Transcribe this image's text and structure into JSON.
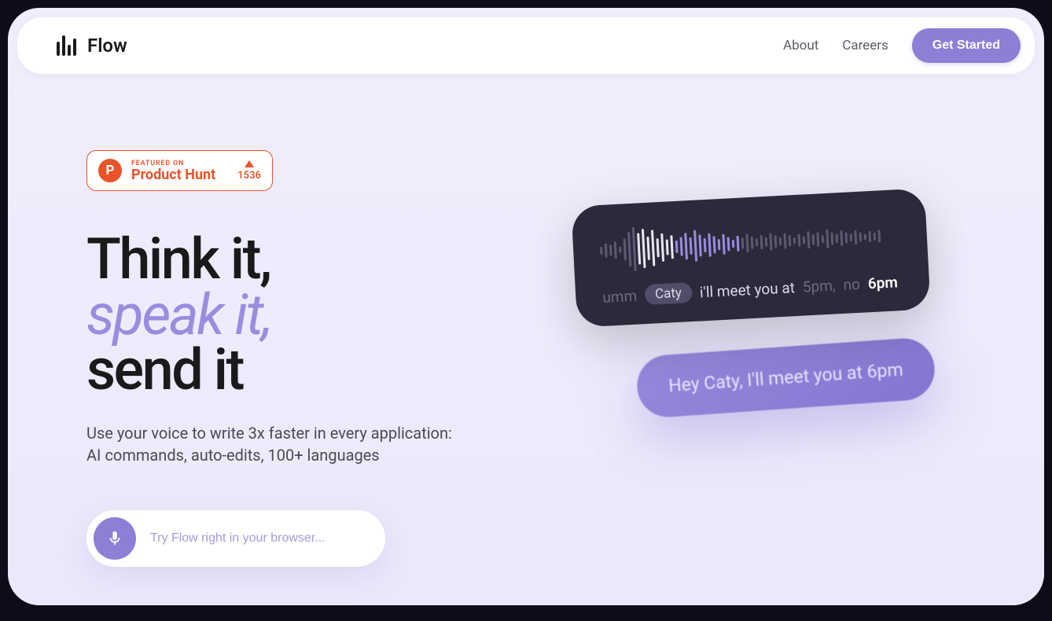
{
  "nav": {
    "brand": "Flow",
    "links": {
      "about": "About",
      "careers": "Careers"
    },
    "cta": "Get Started"
  },
  "ph": {
    "featured": "FEATURED ON",
    "name": "Product Hunt",
    "count": "1536"
  },
  "headline": {
    "line1": "Think it,",
    "line2": "speak it,",
    "line3": "send it"
  },
  "subheadline": {
    "line1": "Use your voice to write 3x faster in every application:",
    "line2": "AI commands, auto-edits, 100+ languages"
  },
  "try_input_placeholder": "Try Flow right in your browser...",
  "voice": {
    "umm": "umm",
    "name": "Caty",
    "part1": "i'll meet you at",
    "time1": "5pm,",
    "no": "no",
    "time2": "6pm"
  },
  "message": "Hey Caty, I'll meet you at 6pm"
}
